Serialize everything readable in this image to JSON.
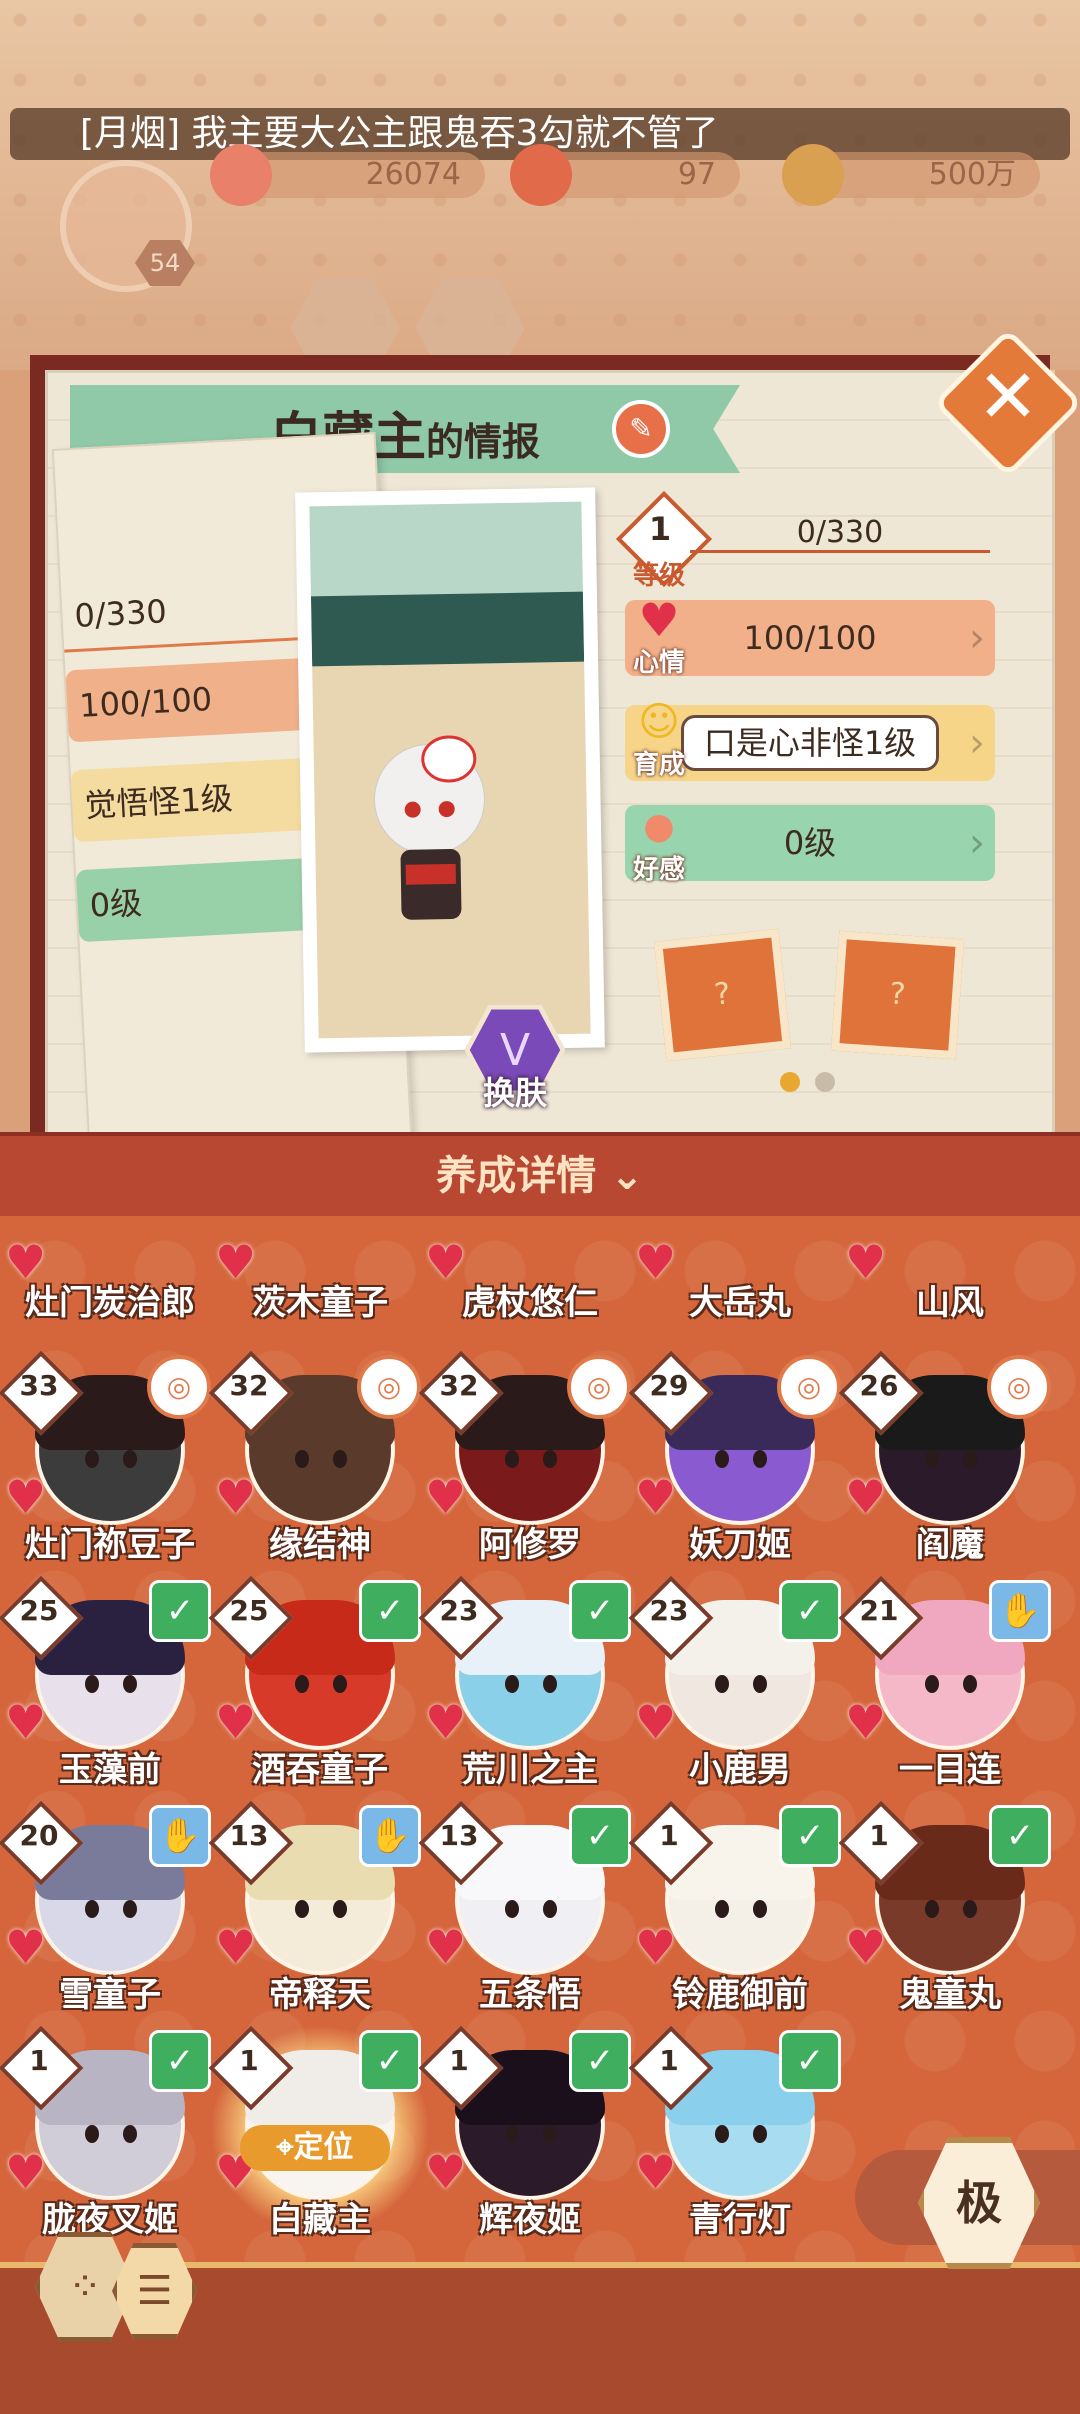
{
  "top": {
    "chat_message": "[月烟] 我主要大公主跟鬼吞3勾就不管了",
    "player_level": "54",
    "resources": [
      "26074",
      "97",
      "500万"
    ]
  },
  "profile": {
    "name": "白藏主",
    "title_suffix": "的情报",
    "level_label": "等级",
    "level_value": "1",
    "exp": "0/330",
    "heart_label": "心情",
    "heart_value": "100/100",
    "grow_label": "育成",
    "grow_value": "口是心非怪1级",
    "fav_label": "好感",
    "fav_value": "0级",
    "skin_label": "换肤",
    "left_page": {
      "exp": "0/330",
      "heart": "100/100",
      "grow": "觉悟怪1级",
      "fav": "0级"
    },
    "sticker_mark": "?"
  },
  "detail_bar": "养成详情",
  "characters_row0": [
    {
      "name": "灶门炭治郎"
    },
    {
      "name": "茨木童子"
    },
    {
      "name": "虎杖悠仁"
    },
    {
      "name": "大岳丸"
    },
    {
      "name": "山风"
    }
  ],
  "characters": [
    {
      "name": "灶门祢豆子",
      "level": "33",
      "badge": "ring",
      "color": "#3c3c3c",
      "hair": "#2a1a1a"
    },
    {
      "name": "缘结神",
      "level": "32",
      "badge": "ring",
      "color": "#5a3a2a",
      "hair": "#5a3a2a"
    },
    {
      "name": "阿修罗",
      "level": "32",
      "badge": "ring",
      "color": "#7a1a1a",
      "hair": "#2a1a1a"
    },
    {
      "name": "妖刀姬",
      "level": "29",
      "badge": "ring",
      "color": "#8a5ad0",
      "hair": "#3a2a5a"
    },
    {
      "name": "阎魔",
      "level": "26",
      "badge": "ring",
      "color": "#2a1a2a",
      "hair": "#1a1a1a"
    },
    {
      "name": "玉藻前",
      "level": "25",
      "badge": "check",
      "color": "#e8e0ea",
      "hair": "#2a2040"
    },
    {
      "name": "酒吞童子",
      "level": "25",
      "badge": "check",
      "color": "#d83a2a",
      "hair": "#c82a1a"
    },
    {
      "name": "荒川之主",
      "level": "23",
      "badge": "check",
      "color": "#8ad0e8",
      "hair": "#e8f0f8"
    },
    {
      "name": "小鹿男",
      "level": "23",
      "badge": "check",
      "color": "#f0e8e0",
      "hair": "#f4f0ea"
    },
    {
      "name": "一目连",
      "level": "21",
      "badge": "hand",
      "color": "#f4b8c8",
      "hair": "#f0a8c0"
    },
    {
      "name": "雪童子",
      "level": "20",
      "badge": "hand",
      "color": "#d8d8e8",
      "hair": "#7a7a9a"
    },
    {
      "name": "帝释天",
      "level": "13",
      "badge": "hand",
      "color": "#f4ecd8",
      "hair": "#e8dcb0"
    },
    {
      "name": "五条悟",
      "level": "13",
      "badge": "check",
      "color": "#f0f0f4",
      "hair": "#f8f8fa"
    },
    {
      "name": "铃鹿御前",
      "level": "1",
      "badge": "check",
      "color": "#f4f0e8",
      "hair": "#f8f4ec"
    },
    {
      "name": "鬼童丸",
      "level": "1",
      "badge": "check",
      "color": "#7a3a2a",
      "hair": "#6a2a1a"
    },
    {
      "name": "胧夜叉姬",
      "level": "1",
      "badge": "check",
      "color": "#d0ccd8",
      "hair": "#b8b4c4"
    },
    {
      "name": "白藏主",
      "level": "1",
      "badge": "check",
      "color": "#f8f4f0",
      "hair": "#f0ece8",
      "locate": "定位"
    },
    {
      "name": "辉夜姬",
      "level": "1",
      "badge": "check",
      "color": "#2a1a2a",
      "hair": "#1a0f1a"
    },
    {
      "name": "青行灯",
      "level": "1",
      "badge": "check",
      "color": "#a8dcf0",
      "hair": "#8ad0ec"
    }
  ],
  "bottom": {
    "ji_button": "极"
  }
}
